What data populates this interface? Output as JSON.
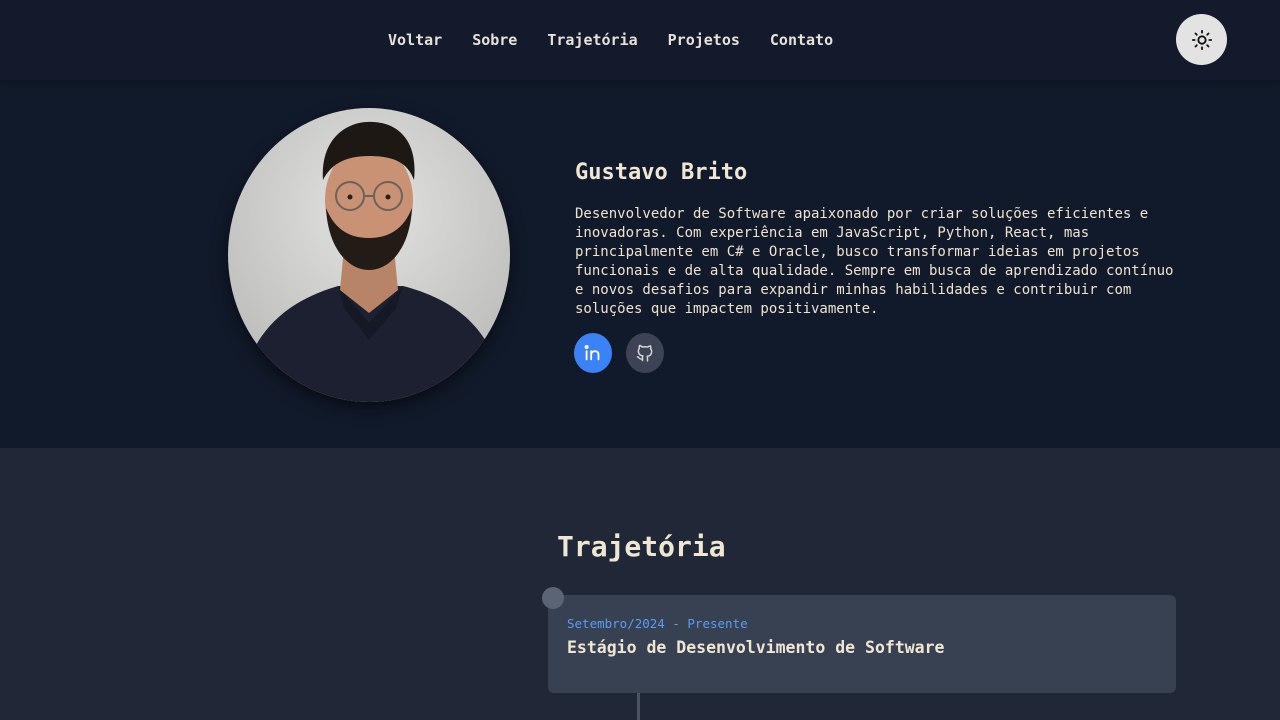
{
  "nav": {
    "items": [
      {
        "label": "Voltar"
      },
      {
        "label": "Sobre"
      },
      {
        "label": "Trajetória"
      },
      {
        "label": "Projetos"
      },
      {
        "label": "Contato"
      }
    ],
    "theme_toggle_icon": "sun-icon"
  },
  "hero": {
    "name": "Gustavo Brito",
    "bio": "Desenvolvedor de Software apaixonado por criar soluções eficientes e inovadoras. Com experiência em JavaScript, Python, React, mas principalmente em C# e Oracle, busco transformar ideias em projetos funcionais e de alta qualidade. Sempre em busca de aprendizado contínuo e novos desafios para expandir minhas habilidades e contribuir com soluções que impactem positivamente.",
    "socials": [
      {
        "icon": "linkedin-icon",
        "color": "#3b82f6"
      },
      {
        "icon": "github-icon",
        "color": "#3b4354"
      }
    ]
  },
  "trajectory": {
    "title": "Trajetória",
    "items": [
      {
        "date": "Setembro/2024 - Presente",
        "title": "Estágio de Desenvolvimento de Software"
      }
    ]
  },
  "colors": {
    "header_bg": "#121a2b",
    "hero_bg": "#111a2b",
    "section_bg": "#202838",
    "card_bg": "#384152",
    "accent": "#5b9cf2",
    "text": "#ede3cf"
  }
}
